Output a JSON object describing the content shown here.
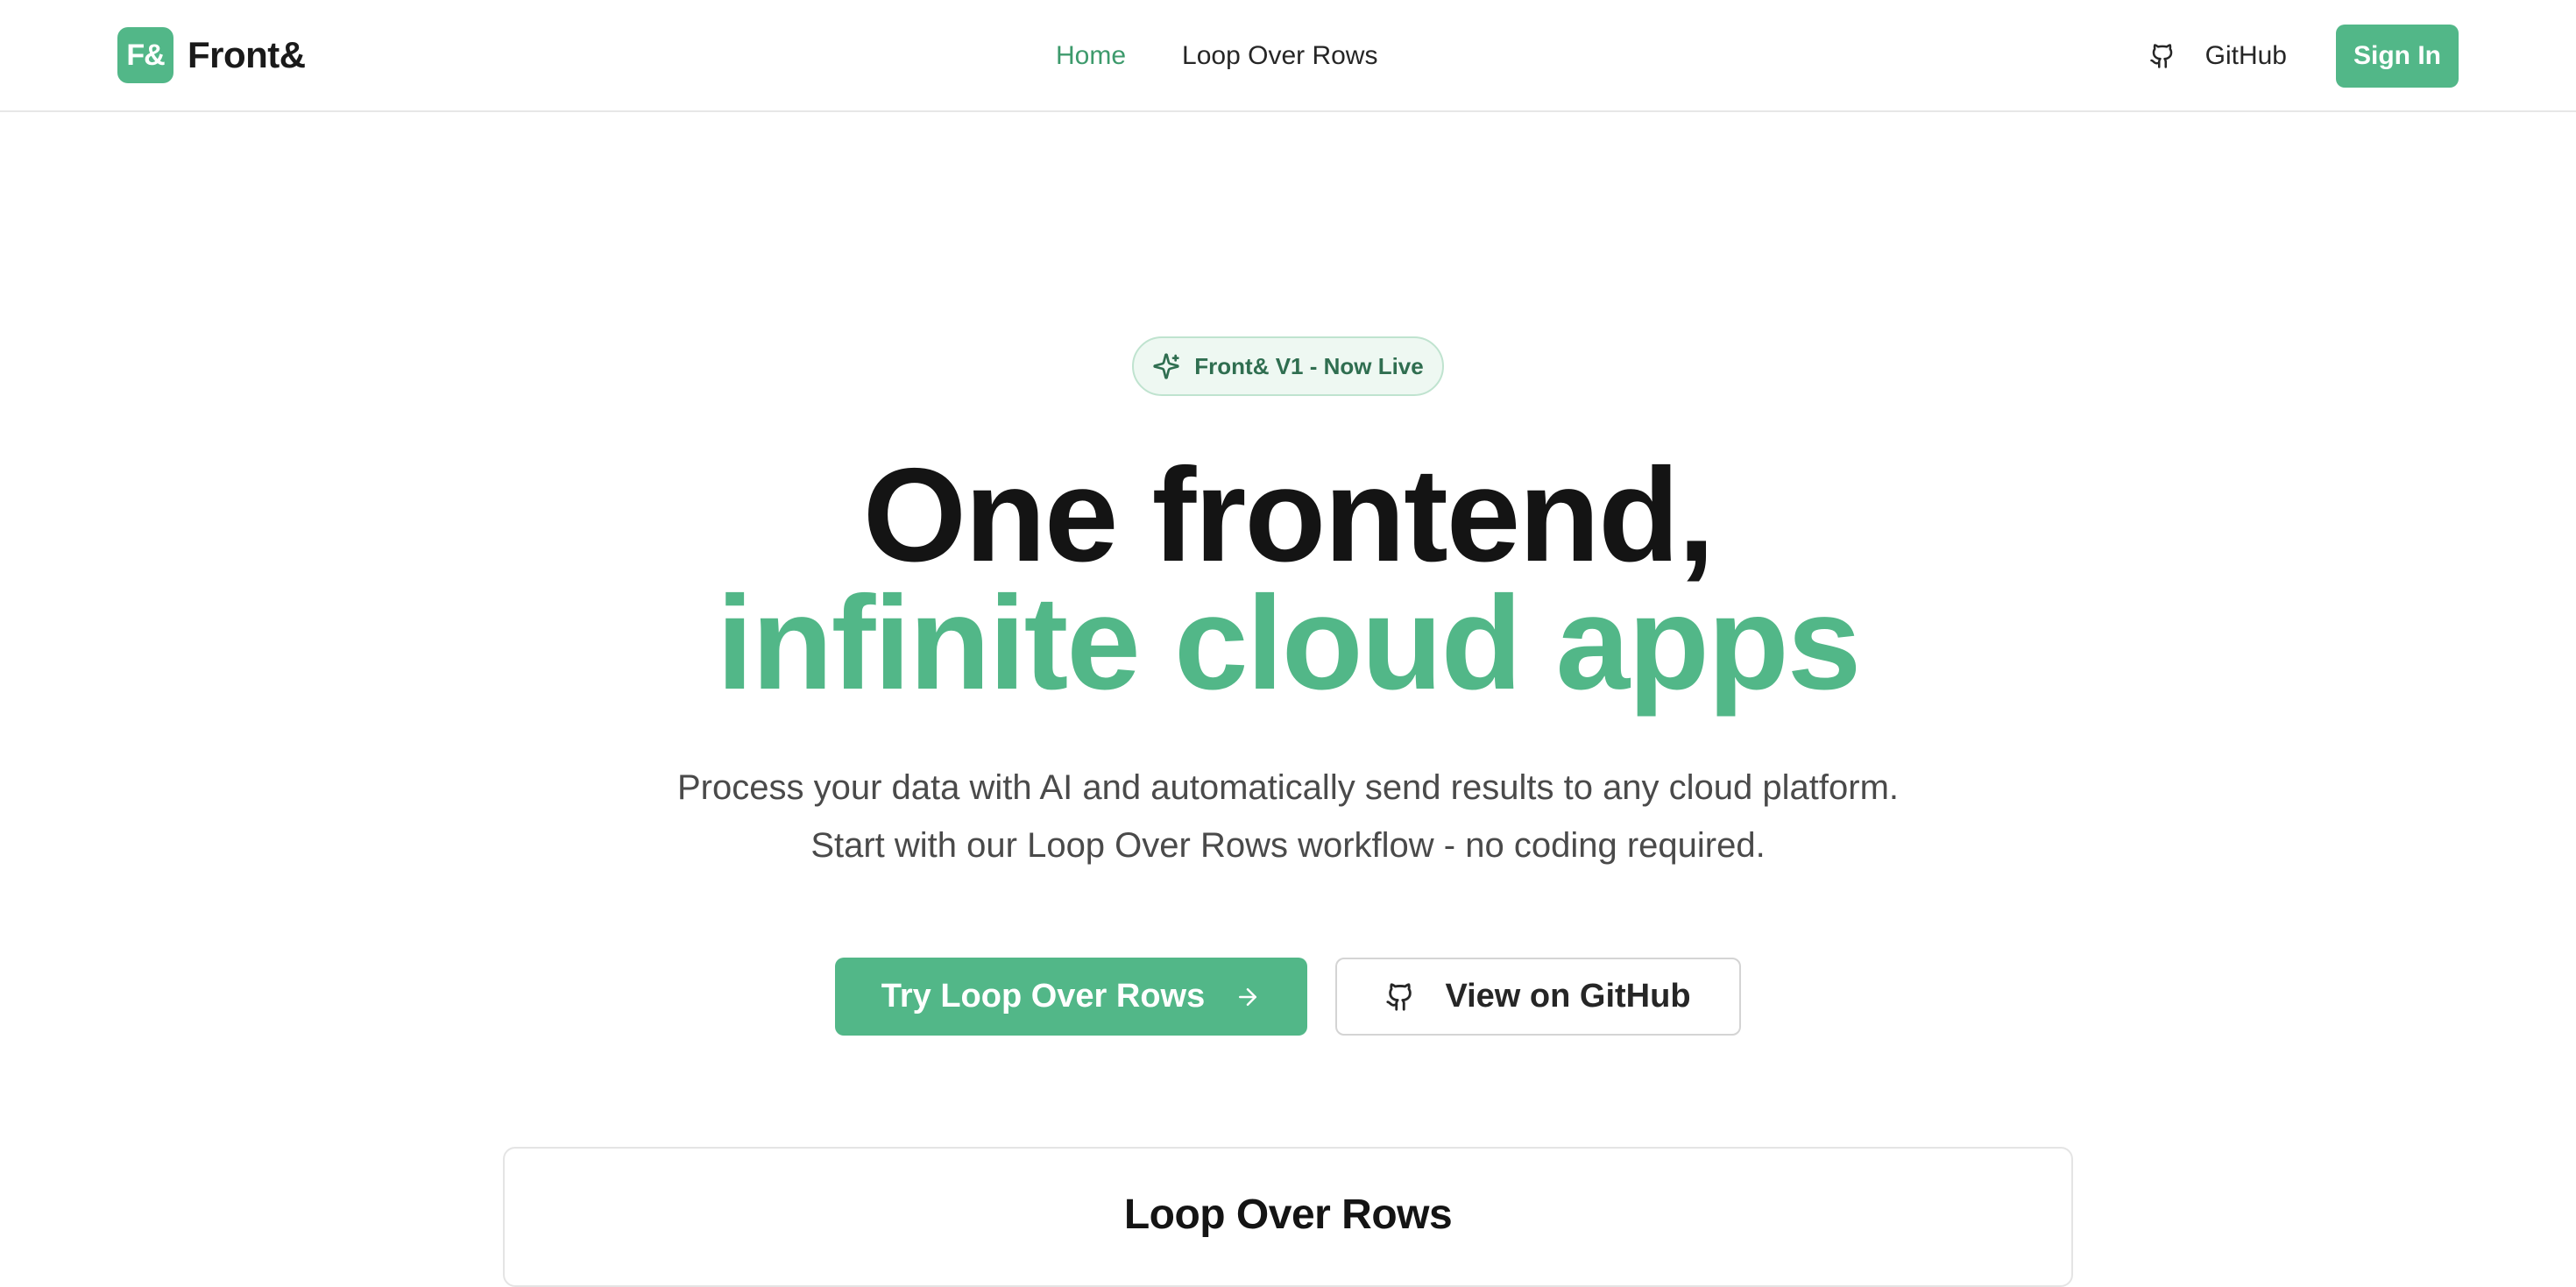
{
  "header": {
    "logo_mark": "F&",
    "brand": "Front&",
    "nav": [
      {
        "label": "Home",
        "active": true
      },
      {
        "label": "Loop Over Rows",
        "active": false
      }
    ],
    "github_label": "GitHub",
    "github_icon": "github-icon",
    "signin_label": "Sign In"
  },
  "hero": {
    "badge_icon": "sparkles-icon",
    "badge": "Front& V1 - Now Live",
    "headline_line1": "One frontend,",
    "headline_line2": "infinite cloud apps",
    "subtitle_line1": "Process your data with AI and automatically send results to any cloud platform.",
    "subtitle_line2": "Start with our Loop Over Rows workflow - no coding required.",
    "primary_cta": "Try Loop Over Rows",
    "primary_cta_icon": "arrow-right-icon",
    "secondary_cta": "View on GitHub",
    "secondary_cta_icon": "github-icon"
  },
  "preview_card": {
    "title": "Loop Over Rows"
  },
  "colors": {
    "accent": "#52b788",
    "accent_text": "#3d9a6c",
    "badge_bg": "#eef8f2",
    "text": "#141414",
    "muted": "#4a4a4a"
  }
}
